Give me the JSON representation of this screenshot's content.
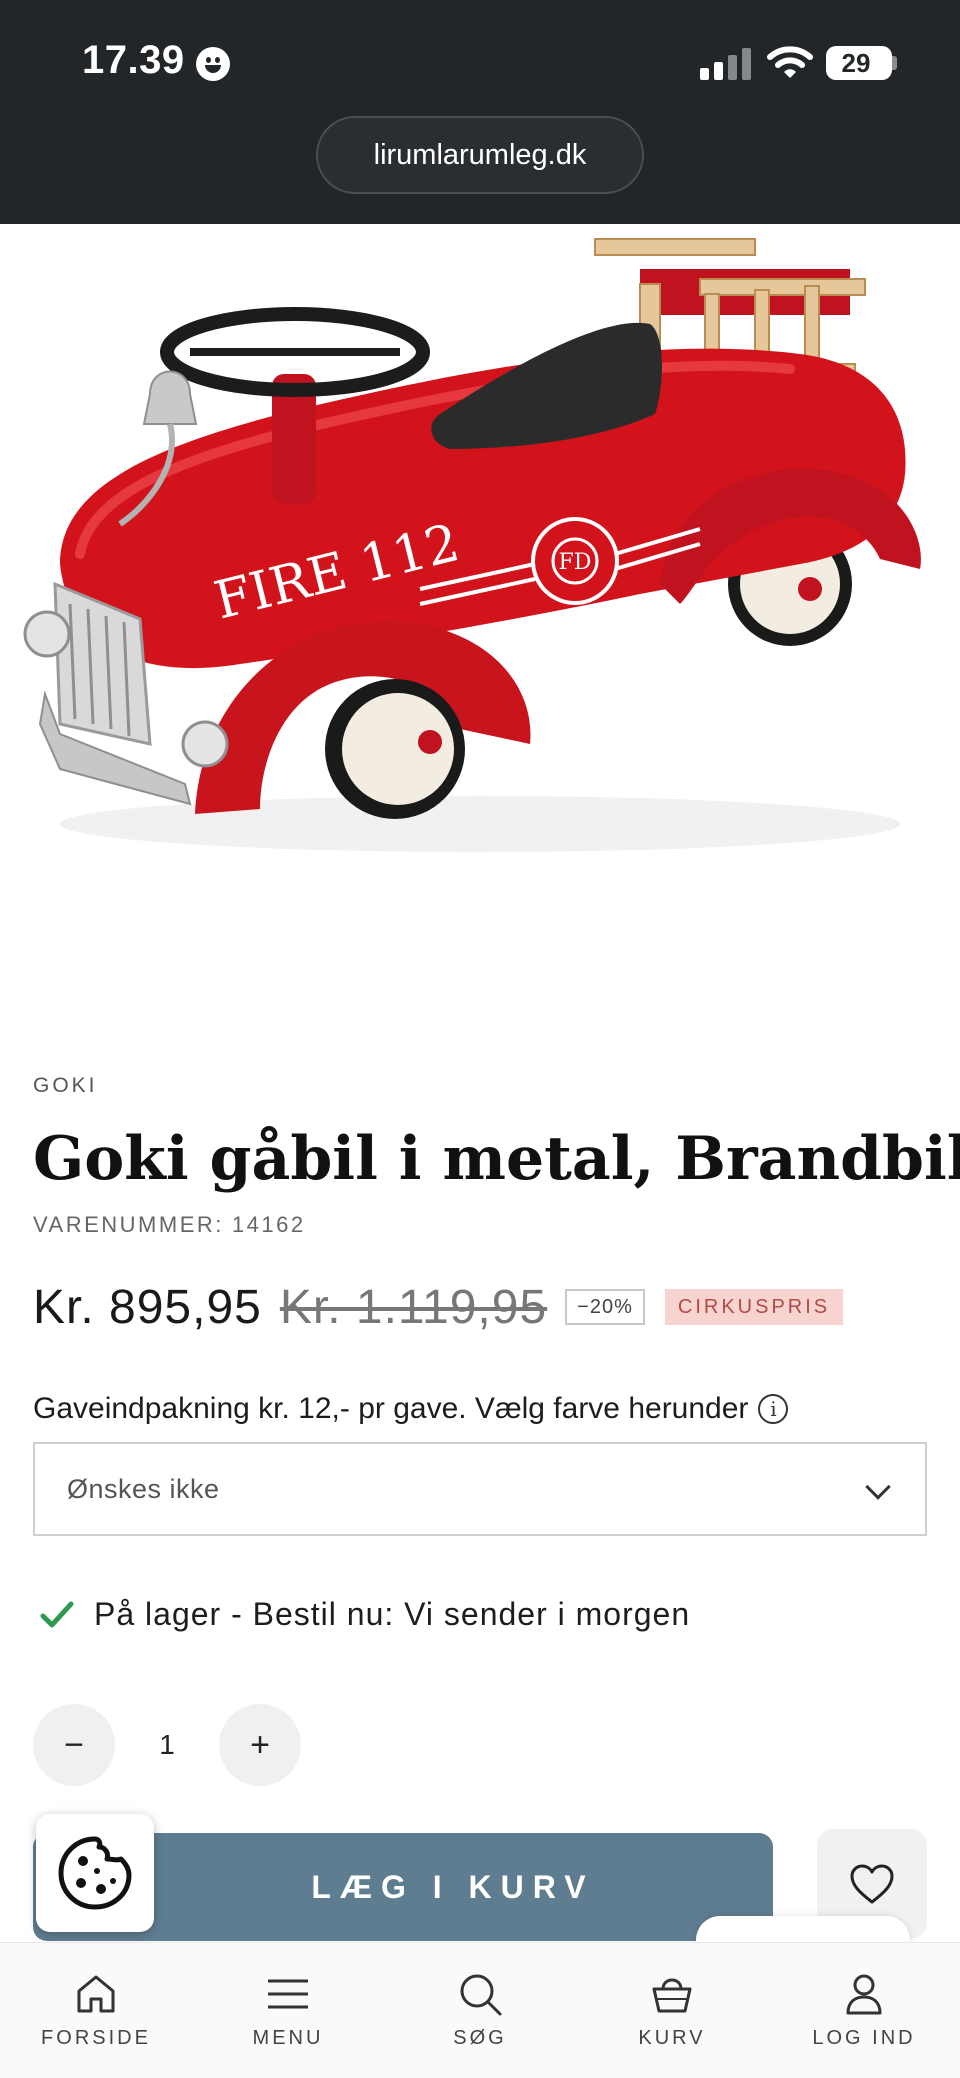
{
  "status_bar": {
    "time": "17.39",
    "battery": "29"
  },
  "browser": {
    "url": "lirumlarumleg.dk"
  },
  "product": {
    "image_alt": "Goki gåbil i metal, Brandbil",
    "image_text": "FIRE 112",
    "image_emblem_text": "FD",
    "brand": "GOKI",
    "title": "Goki gåbil i metal, Brandbil",
    "sku_label": "VARENUMMER:",
    "sku": "14162",
    "price": "Kr. 895,95",
    "old_price": "Kr. 1.119,95",
    "discount": "−20%",
    "badge": "CIRKUSPRIS",
    "badge_color": "#f8d4d1"
  },
  "gift_wrap": {
    "label": "Gaveindpakning kr. 12,- pr gave. Vælg farve herunder",
    "info_icon": "i",
    "selected": "Ønskes ikke"
  },
  "stock": {
    "text": "På lager - Bestil nu: Vi sender i morgen",
    "color": "#2e9a4f"
  },
  "quantity": {
    "minus": "−",
    "value": "1",
    "plus": "+"
  },
  "cart": {
    "add_label": "LÆG I KURV",
    "button_color": "#5f7d90"
  },
  "bottom_nav": {
    "items": [
      {
        "label": "FORSIDE",
        "icon": "home-icon"
      },
      {
        "label": "MENU",
        "icon": "menu-icon"
      },
      {
        "label": "SØG",
        "icon": "search-icon"
      },
      {
        "label": "KURV",
        "icon": "basket-icon"
      },
      {
        "label": "LOG IND",
        "icon": "user-icon"
      }
    ]
  }
}
